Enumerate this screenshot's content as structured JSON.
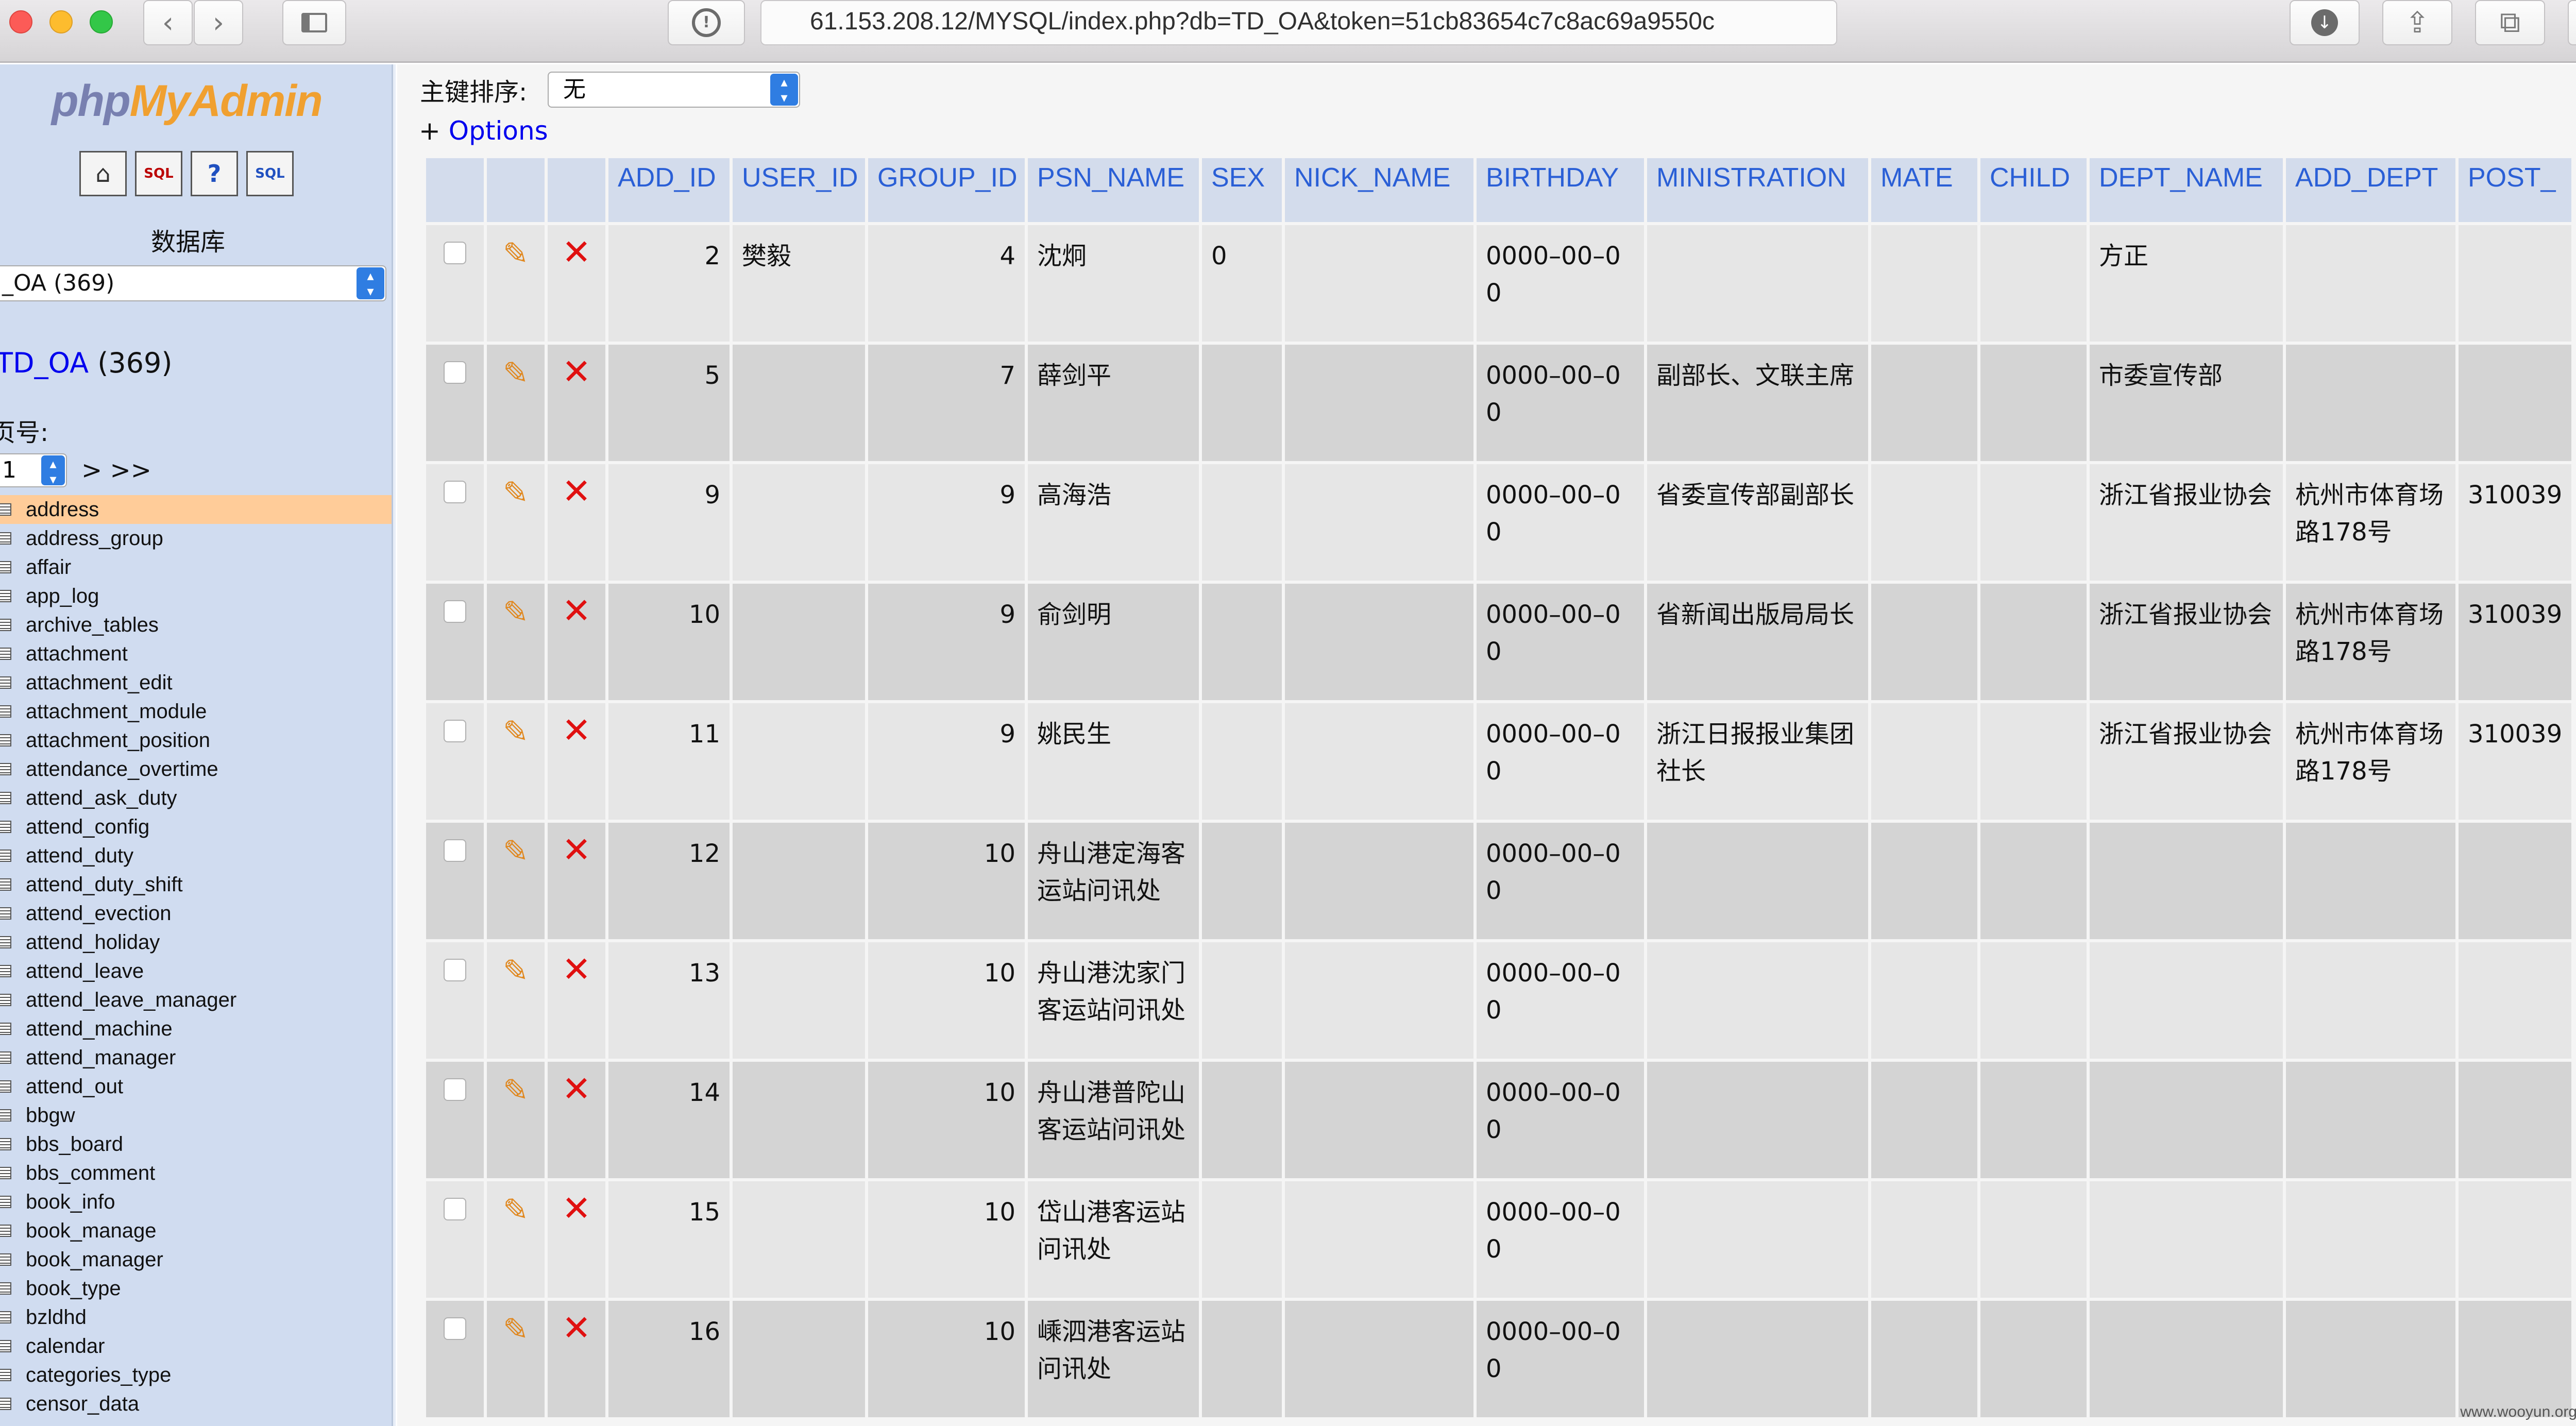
{
  "browser": {
    "url": "61.153.208.12/MYSQL/index.php?db=TD_OA&token=51cb83654c7c8ac69a9550c"
  },
  "colors": {
    "accent_link": "#0000ee",
    "header_text": "#2a5fd6",
    "highlight_row": "#ffcc99",
    "delete_red": "#e01010"
  },
  "sidebar": {
    "logo_php": "php",
    "logo_myadmin": "MyAdmin",
    "db_label": "数据库",
    "db_select_value": "_OA (369)",
    "db_name": "TD_OA",
    "db_count": " (369)",
    "page_label": "页号:",
    "page_value": "1",
    "page_nav": "> >>",
    "tables": [
      "address",
      "address_group",
      "affair",
      "app_log",
      "archive_tables",
      "attachment",
      "attachment_edit",
      "attachment_module",
      "attachment_position",
      "attendance_overtime",
      "attend_ask_duty",
      "attend_config",
      "attend_duty",
      "attend_duty_shift",
      "attend_evection",
      "attend_holiday",
      "attend_leave",
      "attend_leave_manager",
      "attend_machine",
      "attend_manager",
      "attend_out",
      "bbgw",
      "bbs_board",
      "bbs_comment",
      "book_info",
      "book_manage",
      "book_manager",
      "book_type",
      "bzldhd",
      "calendar",
      "categories_type",
      "censor_data"
    ],
    "active_table": "address"
  },
  "main": {
    "sort_label": "主键排序:",
    "sort_value": "无",
    "options_plus": "+ ",
    "options_label": "Options",
    "columns": [
      "ADD_ID",
      "USER_ID",
      "GROUP_ID",
      "PSN_NAME",
      "SEX",
      "NICK_NAME",
      "BIRTHDAY",
      "MINISTRATION",
      "MATE",
      "CHILD",
      "DEPT_NAME",
      "ADD_DEPT",
      "POST_"
    ],
    "rows": [
      {
        "ADD_ID": "2",
        "USER_ID": "樊毅",
        "GROUP_ID": "4",
        "PSN_NAME": "沈炯",
        "SEX": "0",
        "NICK_NAME": "",
        "BIRTHDAY": "0000–00–00",
        "MINISTRATION": "",
        "MATE": "",
        "CHILD": "",
        "DEPT_NAME": "方正",
        "ADD_DEPT": "",
        "POST_": ""
      },
      {
        "ADD_ID": "5",
        "USER_ID": "",
        "GROUP_ID": "7",
        "PSN_NAME": "薛剑平",
        "SEX": "",
        "NICK_NAME": "",
        "BIRTHDAY": "0000–00–00",
        "MINISTRATION": "副部长、文联主席",
        "MATE": "",
        "CHILD": "",
        "DEPT_NAME": "市委宣传部",
        "ADD_DEPT": "",
        "POST_": ""
      },
      {
        "ADD_ID": "9",
        "USER_ID": "",
        "GROUP_ID": "9",
        "PSN_NAME": "高海浩",
        "SEX": "",
        "NICK_NAME": "",
        "BIRTHDAY": "0000–00–00",
        "MINISTRATION": "省委宣传部副部长",
        "MATE": "",
        "CHILD": "",
        "DEPT_NAME": "浙江省报业协会",
        "ADD_DEPT": "杭州市体育场路178号",
        "POST_": "310039"
      },
      {
        "ADD_ID": "10",
        "USER_ID": "",
        "GROUP_ID": "9",
        "PSN_NAME": "俞剑明",
        "SEX": "",
        "NICK_NAME": "",
        "BIRTHDAY": "0000–00–00",
        "MINISTRATION": "省新闻出版局局长",
        "MATE": "",
        "CHILD": "",
        "DEPT_NAME": "浙江省报业协会",
        "ADD_DEPT": "杭州市体育场路178号",
        "POST_": "310039"
      },
      {
        "ADD_ID": "11",
        "USER_ID": "",
        "GROUP_ID": "9",
        "PSN_NAME": "姚民生",
        "SEX": "",
        "NICK_NAME": "",
        "BIRTHDAY": "0000–00–00",
        "MINISTRATION": "浙江日报报业集团社长",
        "MATE": "",
        "CHILD": "",
        "DEPT_NAME": "浙江省报业协会",
        "ADD_DEPT": "杭州市体育场路178号",
        "POST_": "310039"
      },
      {
        "ADD_ID": "12",
        "USER_ID": "",
        "GROUP_ID": "10",
        "PSN_NAME": "舟山港定海客运站问讯处",
        "SEX": "",
        "NICK_NAME": "",
        "BIRTHDAY": "0000–00–00",
        "MINISTRATION": "",
        "MATE": "",
        "CHILD": "",
        "DEPT_NAME": "",
        "ADD_DEPT": "",
        "POST_": ""
      },
      {
        "ADD_ID": "13",
        "USER_ID": "",
        "GROUP_ID": "10",
        "PSN_NAME": "舟山港沈家门客运站问讯处",
        "SEX": "",
        "NICK_NAME": "",
        "BIRTHDAY": "0000–00–00",
        "MINISTRATION": "",
        "MATE": "",
        "CHILD": "",
        "DEPT_NAME": "",
        "ADD_DEPT": "",
        "POST_": ""
      },
      {
        "ADD_ID": "14",
        "USER_ID": "",
        "GROUP_ID": "10",
        "PSN_NAME": "舟山港普陀山客运站问讯处",
        "SEX": "",
        "NICK_NAME": "",
        "BIRTHDAY": "0000–00–00",
        "MINISTRATION": "",
        "MATE": "",
        "CHILD": "",
        "DEPT_NAME": "",
        "ADD_DEPT": "",
        "POST_": ""
      },
      {
        "ADD_ID": "15",
        "USER_ID": "",
        "GROUP_ID": "10",
        "PSN_NAME": "岱山港客运站问讯处",
        "SEX": "",
        "NICK_NAME": "",
        "BIRTHDAY": "0000–00–00",
        "MINISTRATION": "",
        "MATE": "",
        "CHILD": "",
        "DEPT_NAME": "",
        "ADD_DEPT": "",
        "POST_": ""
      },
      {
        "ADD_ID": "16",
        "USER_ID": "",
        "GROUP_ID": "10",
        "PSN_NAME": "嵊泗港客运站问讯处",
        "SEX": "",
        "NICK_NAME": "",
        "BIRTHDAY": "0000–00–00",
        "MINISTRATION": "",
        "MATE": "",
        "CHILD": "",
        "DEPT_NAME": "",
        "ADD_DEPT": "",
        "POST_": ""
      }
    ]
  },
  "watermark": "www.wooyun.org"
}
